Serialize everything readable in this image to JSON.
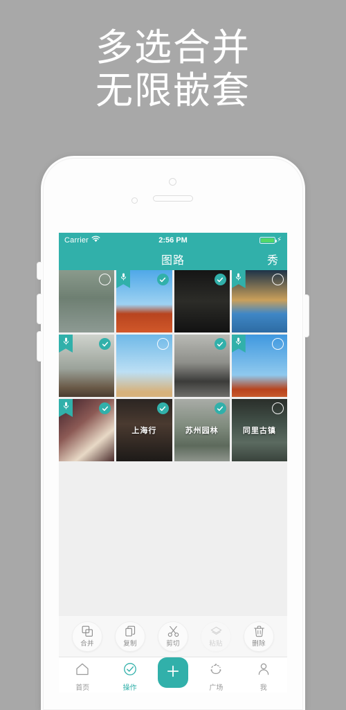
{
  "headline": {
    "line1": "多选合并",
    "line2": "无限嵌套"
  },
  "colors": {
    "background": "#a8a8a8",
    "accent": "#31b0aa",
    "battery": "#53d769",
    "screen_bg": "#efefef"
  },
  "status_bar": {
    "carrier": "Carrier",
    "wifi_icon": "wifi-icon",
    "time": "2:56 PM",
    "battery_icon": "battery-icon",
    "charging_icon": "lightning-bolt-icon"
  },
  "nav_bar": {
    "title": "图路",
    "right_action": "秀"
  },
  "grid": {
    "cells": [
      {
        "label": "",
        "badge": false,
        "selected": false,
        "theme": "pond-trees"
      },
      {
        "label": "",
        "badge": true,
        "selected": true,
        "theme": "temple-roof-sky"
      },
      {
        "label": "",
        "badge": false,
        "selected": true,
        "theme": "lattice-window"
      },
      {
        "label": "",
        "badge": true,
        "selected": false,
        "theme": "canal-reflection"
      },
      {
        "label": "",
        "badge": true,
        "selected": true,
        "theme": "courtyard-house"
      },
      {
        "label": "",
        "badge": false,
        "selected": false,
        "theme": "plum-blossom-sky"
      },
      {
        "label": "",
        "badge": false,
        "selected": true,
        "theme": "stone-gateway"
      },
      {
        "label": "",
        "badge": true,
        "selected": false,
        "theme": "blue-sky-eave"
      },
      {
        "label": "",
        "badge": true,
        "selected": true,
        "theme": "magnolia-flower"
      },
      {
        "label": "上海行",
        "badge": false,
        "selected": true,
        "theme": "shanghai-night"
      },
      {
        "label": "苏州园林",
        "badge": false,
        "selected": true,
        "theme": "suzhou-garden"
      },
      {
        "label": "同里古镇",
        "badge": false,
        "selected": false,
        "theme": "tongli-town"
      }
    ]
  },
  "action_bar": {
    "buttons": [
      {
        "label": "合并",
        "icon": "merge-icon",
        "disabled": false
      },
      {
        "label": "复制",
        "icon": "copy-icon",
        "disabled": false
      },
      {
        "label": "剪切",
        "icon": "scissors-icon",
        "disabled": false
      },
      {
        "label": "粘贴",
        "icon": "paste-icon",
        "disabled": true
      },
      {
        "label": "删除",
        "icon": "trash-icon",
        "disabled": false
      }
    ]
  },
  "tab_bar": {
    "tabs": [
      {
        "label": "首页",
        "icon": "home-icon",
        "active": false
      },
      {
        "label": "操作",
        "icon": "check-circle-icon",
        "active": true
      },
      {
        "label": "广场",
        "icon": "plaza-icon",
        "active": false
      },
      {
        "label": "我",
        "icon": "person-icon",
        "active": false
      }
    ],
    "fab": {
      "icon": "plus-icon"
    }
  }
}
